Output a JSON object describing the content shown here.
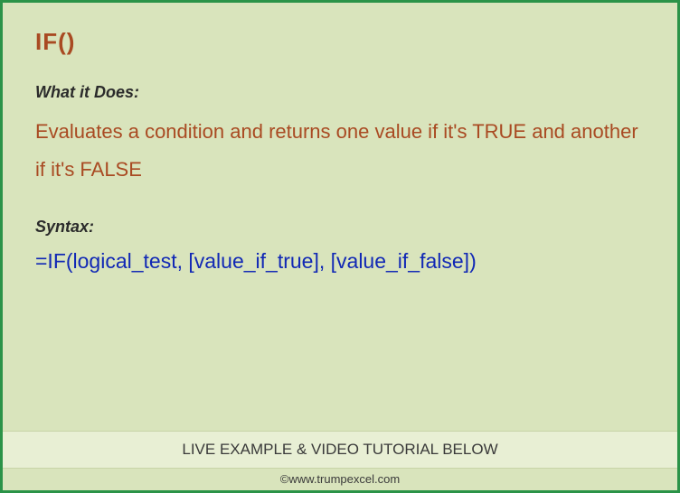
{
  "function": {
    "name": "IF()"
  },
  "sections": {
    "whatItDoes": {
      "label": "What it Does:",
      "text": "Evaluates a condition and returns one value if it's TRUE and another if it's FALSE"
    },
    "syntax": {
      "label": "Syntax:",
      "code": "=IF(logical_test, [value_if_true], [value_if_false])"
    }
  },
  "footer": {
    "banner": "LIVE EXAMPLE & VIDEO TUTORIAL BELOW",
    "copyright": "©www.trumpexcel.com"
  }
}
